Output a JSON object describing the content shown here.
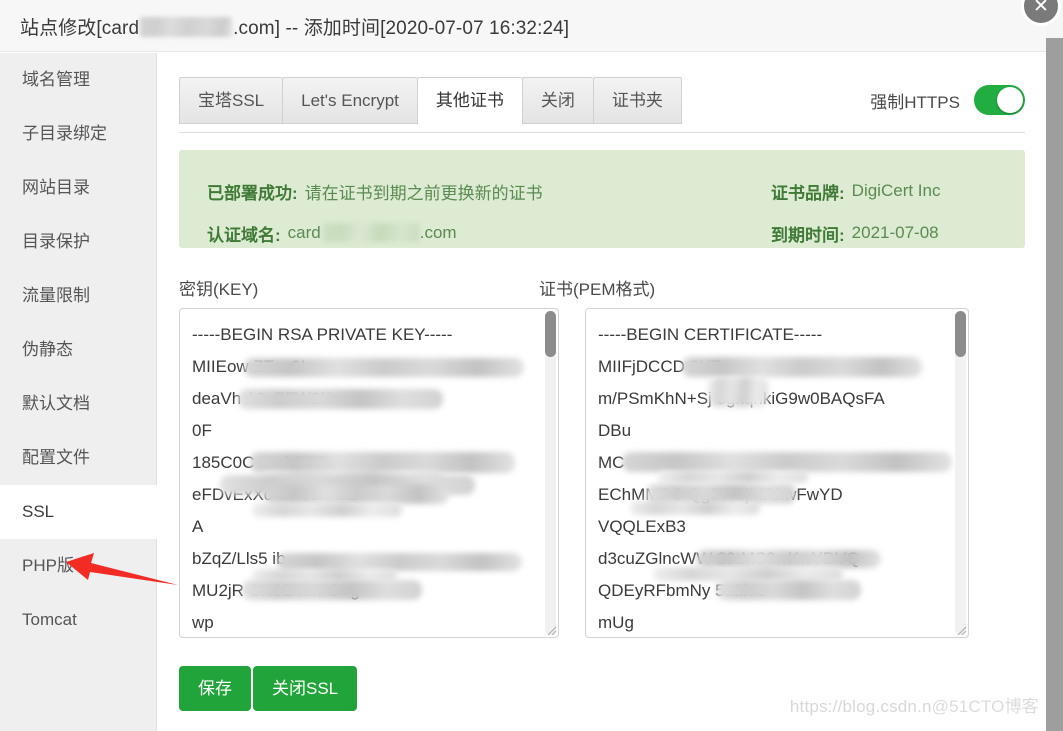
{
  "window": {
    "title_prefix": "站点修改[card",
    "title_domain_redacted": "",
    "title_suffix": ".com] -- 添加时间[2020-07-07 16:32:24]",
    "close_icon": "close-icon",
    "close_glyph": "✕"
  },
  "sidebar": {
    "items": [
      {
        "label": "域名管理",
        "active": false
      },
      {
        "label": "子目录绑定",
        "active": false
      },
      {
        "label": "网站目录",
        "active": false
      },
      {
        "label": "目录保护",
        "active": false
      },
      {
        "label": "流量限制",
        "active": false
      },
      {
        "label": "伪静态",
        "active": false
      },
      {
        "label": "默认文档",
        "active": false
      },
      {
        "label": "配置文件",
        "active": false
      },
      {
        "label": "SSL",
        "active": true
      },
      {
        "label": "PHP版本",
        "active": false
      },
      {
        "label": "Tomcat",
        "active": false
      }
    ]
  },
  "annotation": {
    "arrow_color": "#f22c24",
    "arrow_name": "red-arrow-pointing-to-ssl"
  },
  "tabs": {
    "items": [
      {
        "label": "宝塔SSL",
        "active": false
      },
      {
        "label": "Let's Encrypt",
        "active": false
      },
      {
        "label": "其他证书",
        "active": true
      },
      {
        "label": "关闭",
        "active": false
      },
      {
        "label": "证书夹",
        "active": false
      }
    ]
  },
  "force_https": {
    "label": "强制HTTPS",
    "enabled": true,
    "on_color": "#21ad42"
  },
  "banner": {
    "background_color": "#dcebd2",
    "text_color": "#4f7d46",
    "status_key": "已部署成功:",
    "status_value": "请在证书到期之前更换新的证书",
    "domain_key": "认证域名:",
    "domain_value_prefix": "card",
    "domain_value_suffix": ".com",
    "brand_key": "证书品牌:",
    "brand_value": "DigiCert Inc",
    "expire_key": "到期时间:",
    "expire_value": "2021-07-08"
  },
  "key_field": {
    "label": "密钥(KEY)",
    "lines": [
      "-----BEGIN RSA PRIVATE KEY-----",
      "MIIEow                                    ZTau0I",
      "deaVh                           A9xZFW2K",
      "0F",
      "185C0C                                  UIuhFTFz",
      "eFDvExXc                           wP8shXa2",
      "A",
      "bZqZ/Lls5                            ib",
      "MU2jR                            CK6EVxMG+g",
      "wp"
    ]
  },
  "pem_field": {
    "label": "证书(PEM格式)",
    "lines": [
      "-----BEGIN CERTIFICATE-----",
      "MIIFjDCCD                                8XT",
      "m/PSmKhN+Sj     3gkqhkiG9w0BAQsFA",
      "DBu",
      "MC",
      "EChMMPC                      Qg5W5jMRkwFwYD",
      "VQQLExB3",
      "d3cuZGlncWW                 29tMS0wKwYDVQ",
      "QDEyRFbmNy                        5a2hlc",
      "mUg"
    ]
  },
  "buttons": {
    "save": "保存",
    "close_ssl": "关闭SSL",
    "color": "#21a53b"
  },
  "watermark": {
    "text_a": "https://blog.csdn.n",
    "text_b": "@51CTO博客"
  }
}
